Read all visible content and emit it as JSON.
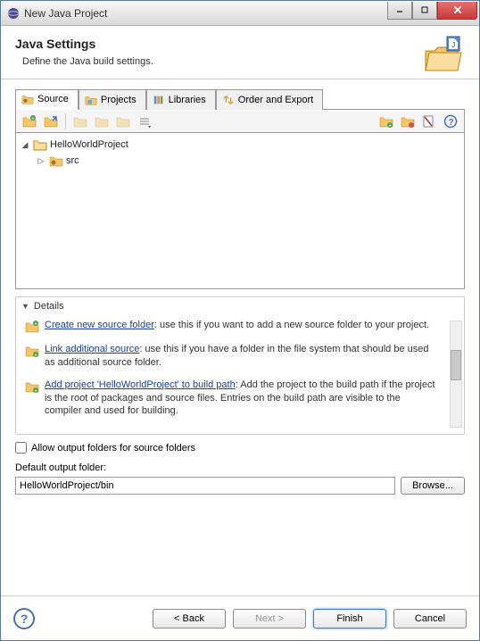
{
  "window": {
    "title": "New Java Project"
  },
  "header": {
    "title": "Java Settings",
    "subtitle": "Define the Java build settings."
  },
  "tabs": [
    {
      "label": "Source",
      "icon": "source-folder-icon"
    },
    {
      "label": "Projects",
      "icon": "projects-icon"
    },
    {
      "label": "Libraries",
      "icon": "libraries-icon"
    },
    {
      "label": "Order and Export",
      "icon": "order-export-icon"
    }
  ],
  "tree": {
    "root": {
      "label": "HelloWorldProject"
    },
    "children": [
      {
        "label": "src"
      }
    ]
  },
  "details": {
    "title": "Details",
    "items": [
      {
        "link": "Create new source folder",
        "rest": ": use this if you want to add a new source folder to your project."
      },
      {
        "link": "Link additional source",
        "rest": ": use this if you have a folder in the file system that should be used as additional source folder."
      },
      {
        "link": "Add project 'HelloWorldProject' to build path",
        "rest": ": Add the project to the build path if the project is the root of packages and source files. Entries on the build path are visible to the compiler and used for building."
      }
    ]
  },
  "allow_output_label": "Allow output folders for source folders",
  "default_output": {
    "label": "Default output folder:",
    "value": "HelloWorldProject/bin",
    "browse": "Browse..."
  },
  "footer": {
    "back": "< Back",
    "next": "Next >",
    "finish": "Finish",
    "cancel": "Cancel"
  }
}
